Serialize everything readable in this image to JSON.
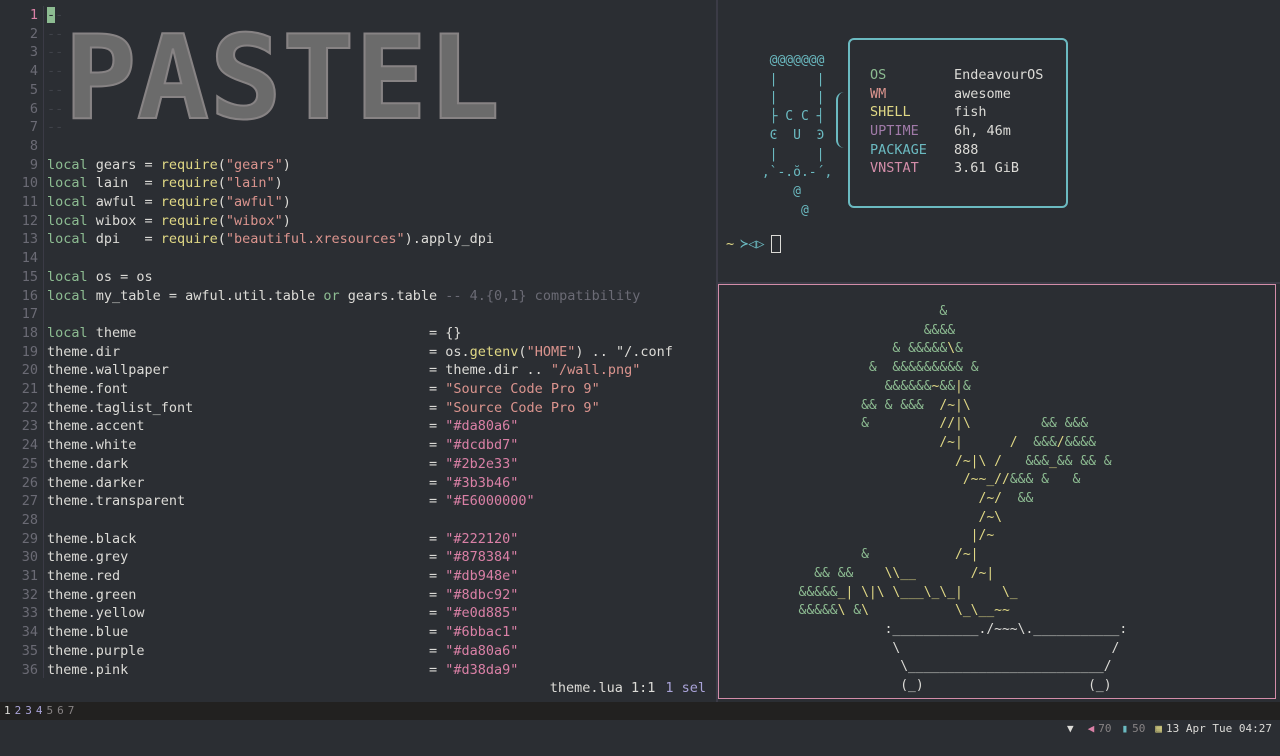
{
  "editor": {
    "banner_text": "PASTEL",
    "lines": [
      {
        "n": "1",
        "t": "--"
      },
      {
        "n": "2",
        "t": "--"
      },
      {
        "n": "3",
        "t": "--"
      },
      {
        "n": "4",
        "t": "--"
      },
      {
        "n": "5",
        "t": "--"
      },
      {
        "n": "6",
        "t": "--"
      },
      {
        "n": "7",
        "t": "--"
      },
      {
        "n": "8",
        "t": ""
      },
      {
        "n": "9",
        "t": "local gears = require(\"gears\")"
      },
      {
        "n": "10",
        "t": "local lain  = require(\"lain\")"
      },
      {
        "n": "11",
        "t": "local awful = require(\"awful\")"
      },
      {
        "n": "12",
        "t": "local wibox = require(\"wibox\")"
      },
      {
        "n": "13",
        "t": "local dpi   = require(\"beautiful.xresources\").apply_dpi"
      },
      {
        "n": "14",
        "t": ""
      },
      {
        "n": "15",
        "t": "local os = os"
      },
      {
        "n": "16",
        "t": "local my_table = awful.util.table or gears.table -- 4.{0,1} compatibility"
      },
      {
        "n": "17",
        "t": ""
      },
      {
        "n": "18",
        "t": "local theme                                    = {}"
      },
      {
        "n": "19",
        "t": "theme.dir                                      = os.getenv(\"HOME\") .. \"/.conf"
      },
      {
        "n": "20",
        "t": "theme.wallpaper                                = theme.dir .. \"/wall.png\""
      },
      {
        "n": "21",
        "t": "theme.font                                     = \"Source Code Pro 9\""
      },
      {
        "n": "22",
        "t": "theme.taglist_font                             = \"Source Code Pro 9\""
      },
      {
        "n": "23",
        "t": "theme.accent                                   = \"#da80a6\""
      },
      {
        "n": "24",
        "t": "theme.white                                    = \"#dcdbd7\""
      },
      {
        "n": "25",
        "t": "theme.dark                                     = \"#2b2e33\""
      },
      {
        "n": "26",
        "t": "theme.darker                                   = \"#3b3b46\""
      },
      {
        "n": "27",
        "t": "theme.transparent                              = \"#E6000000\""
      },
      {
        "n": "28",
        "t": ""
      },
      {
        "n": "29",
        "t": "theme.black                                    = \"#222120\""
      },
      {
        "n": "30",
        "t": "theme.grey                                     = \"#878384\""
      },
      {
        "n": "31",
        "t": "theme.red                                      = \"#db948e\""
      },
      {
        "n": "32",
        "t": "theme.green                                    = \"#8dbc92\""
      },
      {
        "n": "33",
        "t": "theme.yellow                                   = \"#e0d885\""
      },
      {
        "n": "34",
        "t": "theme.blue                                     = \"#6bbac1\""
      },
      {
        "n": "35",
        "t": "theme.purple                                   = \"#da80a6\""
      },
      {
        "n": "36",
        "t": "theme.pink                                     = \"#d38da9\""
      }
    ],
    "status": {
      "file": "theme.lua 1:1",
      "selection": "1 sel"
    }
  },
  "fetch": {
    "ascii": [
      "  @@@@@@@",
      "  |     |",
      "  |     |",
      "  ├ C C ┤",
      "  Ͼ  U  Ͽ",
      "  |     |",
      " ,`-.ŏ.-´,",
      "     @",
      "      @"
    ],
    "info": [
      {
        "key": "OS",
        "value": "EndeavourOS",
        "color": "#8dbc92"
      },
      {
        "key": "WM",
        "value": "awesome",
        "color": "#db948e"
      },
      {
        "key": "SHELL",
        "value": "fish",
        "color": "#e0d885"
      },
      {
        "key": "UPTIME",
        "value": "6h, 46m",
        "color": "#a07aa8"
      },
      {
        "key": "PACKAGE",
        "value": "888",
        "color": "#6bbac1"
      },
      {
        "key": "VNSTAT",
        "value": "3.61 GiB",
        "color": "#d38da9"
      }
    ],
    "prompt": {
      "dir": "~",
      "symbol": "≻◁▷"
    }
  },
  "bonsai": {
    "lines": [
      "                     &",
      "                   &&&&",
      "               & &&&&&\\&",
      "            &  &&&&&&&&& &",
      "              &&&&&&~&&|&",
      "           && & &&&  /~|\\",
      "           &         //|\\         && &&&",
      "                     /~|      /  &&&/&&&&",
      "                       /~|\\ /   &&&_&& && &",
      "                        /~~_//&&& &   &",
      "                          /~/  &&",
      "                          /~\\",
      "                         |/~",
      "           &           /~|",
      "     && &&    \\\\__       /~|",
      "   &&&&&_| \\|\\ \\___\\_\\_|     \\_",
      "   &&&&&\\ &\\           \\_\\__~~",
      "              :___________./~~~\\.___________:",
      "               \\                           /",
      "                \\_________________________/",
      "                (_)                     (_)"
    ]
  },
  "bar": {
    "tags": [
      "1",
      "2",
      "3",
      "4",
      "5",
      "6",
      "7"
    ],
    "volume": "70",
    "battery": "50",
    "clock": "13 Apr Tue 04:27"
  }
}
